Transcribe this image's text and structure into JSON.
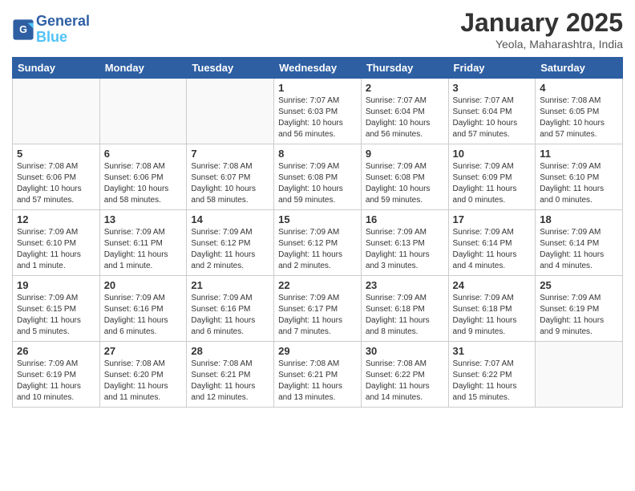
{
  "header": {
    "logo_line1": "General",
    "logo_line2": "Blue",
    "title": "January 2025",
    "subtitle": "Yeola, Maharashtra, India"
  },
  "days_of_week": [
    "Sunday",
    "Monday",
    "Tuesday",
    "Wednesday",
    "Thursday",
    "Friday",
    "Saturday"
  ],
  "weeks": [
    {
      "cells": [
        {
          "day": "",
          "info": ""
        },
        {
          "day": "",
          "info": ""
        },
        {
          "day": "",
          "info": ""
        },
        {
          "day": "1",
          "info": "Sunrise: 7:07 AM\nSunset: 6:03 PM\nDaylight: 10 hours\nand 56 minutes."
        },
        {
          "day": "2",
          "info": "Sunrise: 7:07 AM\nSunset: 6:04 PM\nDaylight: 10 hours\nand 56 minutes."
        },
        {
          "day": "3",
          "info": "Sunrise: 7:07 AM\nSunset: 6:04 PM\nDaylight: 10 hours\nand 57 minutes."
        },
        {
          "day": "4",
          "info": "Sunrise: 7:08 AM\nSunset: 6:05 PM\nDaylight: 10 hours\nand 57 minutes."
        }
      ]
    },
    {
      "cells": [
        {
          "day": "5",
          "info": "Sunrise: 7:08 AM\nSunset: 6:06 PM\nDaylight: 10 hours\nand 57 minutes."
        },
        {
          "day": "6",
          "info": "Sunrise: 7:08 AM\nSunset: 6:06 PM\nDaylight: 10 hours\nand 58 minutes."
        },
        {
          "day": "7",
          "info": "Sunrise: 7:08 AM\nSunset: 6:07 PM\nDaylight: 10 hours\nand 58 minutes."
        },
        {
          "day": "8",
          "info": "Sunrise: 7:09 AM\nSunset: 6:08 PM\nDaylight: 10 hours\nand 59 minutes."
        },
        {
          "day": "9",
          "info": "Sunrise: 7:09 AM\nSunset: 6:08 PM\nDaylight: 10 hours\nand 59 minutes."
        },
        {
          "day": "10",
          "info": "Sunrise: 7:09 AM\nSunset: 6:09 PM\nDaylight: 11 hours\nand 0 minutes."
        },
        {
          "day": "11",
          "info": "Sunrise: 7:09 AM\nSunset: 6:10 PM\nDaylight: 11 hours\nand 0 minutes."
        }
      ]
    },
    {
      "cells": [
        {
          "day": "12",
          "info": "Sunrise: 7:09 AM\nSunset: 6:10 PM\nDaylight: 11 hours\nand 1 minute."
        },
        {
          "day": "13",
          "info": "Sunrise: 7:09 AM\nSunset: 6:11 PM\nDaylight: 11 hours\nand 1 minute."
        },
        {
          "day": "14",
          "info": "Sunrise: 7:09 AM\nSunset: 6:12 PM\nDaylight: 11 hours\nand 2 minutes."
        },
        {
          "day": "15",
          "info": "Sunrise: 7:09 AM\nSunset: 6:12 PM\nDaylight: 11 hours\nand 2 minutes."
        },
        {
          "day": "16",
          "info": "Sunrise: 7:09 AM\nSunset: 6:13 PM\nDaylight: 11 hours\nand 3 minutes."
        },
        {
          "day": "17",
          "info": "Sunrise: 7:09 AM\nSunset: 6:14 PM\nDaylight: 11 hours\nand 4 minutes."
        },
        {
          "day": "18",
          "info": "Sunrise: 7:09 AM\nSunset: 6:14 PM\nDaylight: 11 hours\nand 4 minutes."
        }
      ]
    },
    {
      "cells": [
        {
          "day": "19",
          "info": "Sunrise: 7:09 AM\nSunset: 6:15 PM\nDaylight: 11 hours\nand 5 minutes."
        },
        {
          "day": "20",
          "info": "Sunrise: 7:09 AM\nSunset: 6:16 PM\nDaylight: 11 hours\nand 6 minutes."
        },
        {
          "day": "21",
          "info": "Sunrise: 7:09 AM\nSunset: 6:16 PM\nDaylight: 11 hours\nand 6 minutes."
        },
        {
          "day": "22",
          "info": "Sunrise: 7:09 AM\nSunset: 6:17 PM\nDaylight: 11 hours\nand 7 minutes."
        },
        {
          "day": "23",
          "info": "Sunrise: 7:09 AM\nSunset: 6:18 PM\nDaylight: 11 hours\nand 8 minutes."
        },
        {
          "day": "24",
          "info": "Sunrise: 7:09 AM\nSunset: 6:18 PM\nDaylight: 11 hours\nand 9 minutes."
        },
        {
          "day": "25",
          "info": "Sunrise: 7:09 AM\nSunset: 6:19 PM\nDaylight: 11 hours\nand 9 minutes."
        }
      ]
    },
    {
      "cells": [
        {
          "day": "26",
          "info": "Sunrise: 7:09 AM\nSunset: 6:19 PM\nDaylight: 11 hours\nand 10 minutes."
        },
        {
          "day": "27",
          "info": "Sunrise: 7:08 AM\nSunset: 6:20 PM\nDaylight: 11 hours\nand 11 minutes."
        },
        {
          "day": "28",
          "info": "Sunrise: 7:08 AM\nSunset: 6:21 PM\nDaylight: 11 hours\nand 12 minutes."
        },
        {
          "day": "29",
          "info": "Sunrise: 7:08 AM\nSunset: 6:21 PM\nDaylight: 11 hours\nand 13 minutes."
        },
        {
          "day": "30",
          "info": "Sunrise: 7:08 AM\nSunset: 6:22 PM\nDaylight: 11 hours\nand 14 minutes."
        },
        {
          "day": "31",
          "info": "Sunrise: 7:07 AM\nSunset: 6:22 PM\nDaylight: 11 hours\nand 15 minutes."
        },
        {
          "day": "",
          "info": ""
        }
      ]
    }
  ]
}
